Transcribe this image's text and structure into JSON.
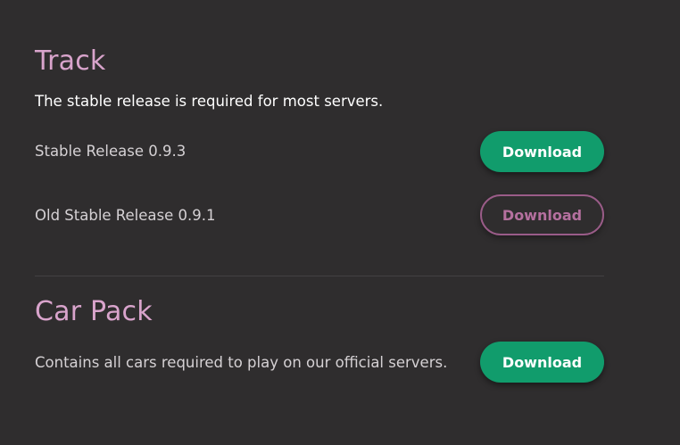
{
  "track": {
    "title": "Track",
    "note": "The stable release is required for most servers.",
    "stable": {
      "label": "Stable Release 0.9.3",
      "button": "Download"
    },
    "old_stable": {
      "label": "Old Stable Release 0.9.1",
      "button": "Download"
    }
  },
  "car_pack": {
    "title": "Car Pack",
    "description": "Contains all cars required to play on our official servers.",
    "button": "Download"
  },
  "colors": {
    "background": "#2f2d2e",
    "heading": "#d9a4cc",
    "primary_button": "#119c6c",
    "outline_button": "#9a5c88"
  }
}
